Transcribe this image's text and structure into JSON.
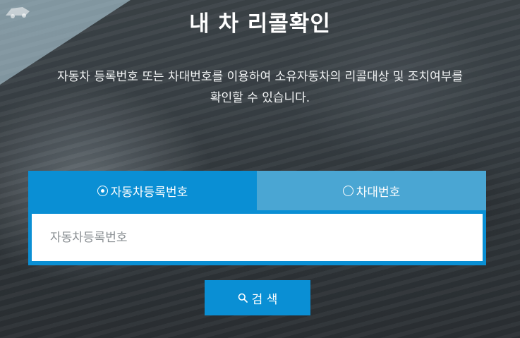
{
  "page": {
    "title": "내 차 리콜확인",
    "description_line1": "자동차 등록번호 또는 차대번호를 이용하여 소유자동차의 리콜대상 및 조치여부를",
    "description_line2": "확인할 수 있습니다."
  },
  "tabs": [
    {
      "label": "자동차등록번호",
      "selected": true
    },
    {
      "label": "차대번호",
      "selected": false
    }
  ],
  "search": {
    "placeholder": "자동차등록번호",
    "value": "",
    "button_label": "검 색"
  },
  "colors": {
    "accent": "#0a8fd4",
    "tab_inactive": "#4aa6d3"
  }
}
